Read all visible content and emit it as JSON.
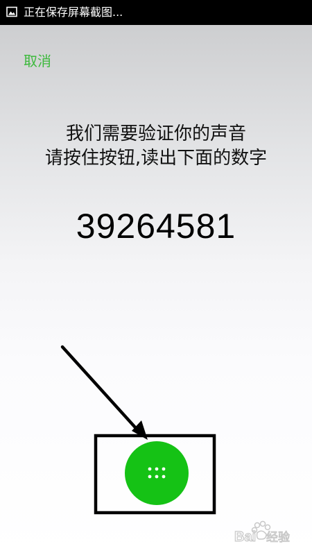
{
  "status_bar": {
    "notification_icon": "image-icon",
    "text": "正在保存屏幕截图..."
  },
  "cancel_label": "取消",
  "instructions": {
    "line1": "我们需要验证你的声音",
    "line2": "请按住按钮,读出下面的数字"
  },
  "verification_code": "39264581",
  "talk_button": {
    "icon": "dots-grid-icon",
    "color": "#15c215"
  },
  "colors": {
    "accent_green": "#3cb93c",
    "annotation": "#000000"
  },
  "watermark": {
    "type": "baidu-jingyan-logo",
    "text": "Bai 经验"
  }
}
